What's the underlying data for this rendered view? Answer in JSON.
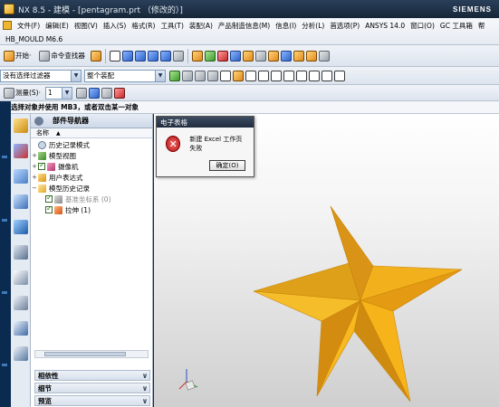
{
  "window": {
    "title": "NX 8.5 - 建模 - [pentagram.prt （修改的）]",
    "brand": "SIEMENS"
  },
  "menubar": {
    "items": [
      "文件(F)",
      "编辑(E)",
      "视图(V)",
      "插入(S)",
      "格式(R)",
      "工具(T)",
      "装配(A)",
      "产品制造信息(M)",
      "信息(I)",
      "分析(L)",
      "首选项(P)",
      "ANSYS 14.0",
      "窗口(O)",
      "GC 工具箱",
      "帮"
    ],
    "module": "HB_MOULD M6.6"
  },
  "toolbar1": {
    "start_label": "开始·",
    "command_finder_label": "命令查找器"
  },
  "toolbar2": {
    "selection_filter": "没有选择过滤器",
    "scope": "整个装配"
  },
  "toolbar3": {
    "measure_label": "测量(S)·",
    "layer_value": "1"
  },
  "prompt": {
    "text": "选择对象并使用 MB3，或者双击某一对象"
  },
  "navigator": {
    "title": "部件导航器",
    "column_name": "名称",
    "tree": [
      {
        "label": "历史记录模式",
        "expand": "",
        "checked": false,
        "muted": false
      },
      {
        "label": "模型视图",
        "expand": "+",
        "checked": false,
        "muted": false
      },
      {
        "label": "摄像机",
        "expand": "+",
        "checked": true,
        "muted": false
      },
      {
        "label": "用户表达式",
        "expand": "+",
        "checked": false,
        "muted": false
      },
      {
        "label": "模型历史记录",
        "expand": "−",
        "checked": false,
        "muted": false
      },
      {
        "label": "基准坐标系 (0)",
        "expand": "",
        "checked": true,
        "muted": true
      },
      {
        "label": "拉伸 (1)",
        "expand": "",
        "checked": true,
        "muted": false
      }
    ],
    "panels": [
      "相依性",
      "细节",
      "预览"
    ]
  },
  "dialog": {
    "title": "电子表格",
    "message": "新建 Excel 工作页失败",
    "ok_label": "确定(O)"
  },
  "colors": {
    "star_light": "#f7b51c",
    "star_dark": "#d08a0a",
    "error_red": "#c41a1a"
  }
}
